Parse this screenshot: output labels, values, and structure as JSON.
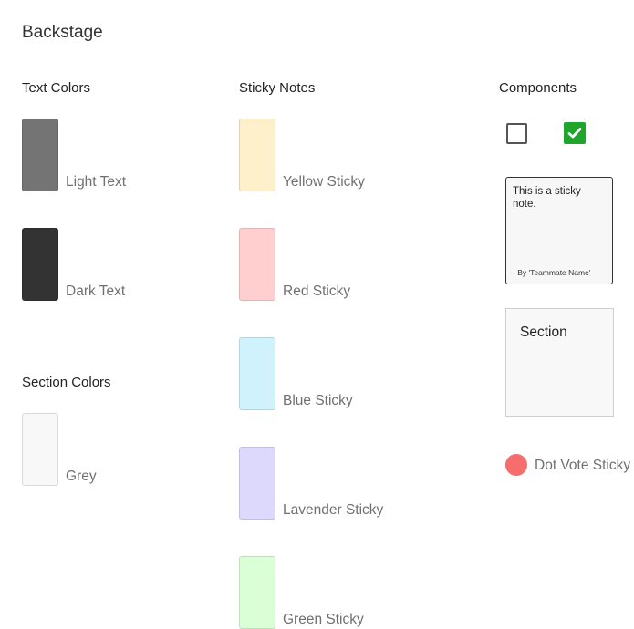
{
  "title": "Backstage",
  "text_colors": {
    "heading": "Text Colors",
    "items": [
      {
        "label": "Light Text",
        "color": "#747474"
      },
      {
        "label": "Dark Text",
        "color": "#333333"
      }
    ]
  },
  "section_colors": {
    "heading": "Section Colors",
    "items": [
      {
        "label": "Grey",
        "color": "#f8f8f8"
      }
    ]
  },
  "sticky_notes": {
    "heading": "Sticky Notes",
    "items": [
      {
        "label": "Yellow Sticky",
        "color": "#fff0cc"
      },
      {
        "label": "Red Sticky",
        "color": "#ffcfd0"
      },
      {
        "label": "Blue Sticky",
        "color": "#cff2fc"
      },
      {
        "label": "Lavender Sticky",
        "color": "#dcd9fd"
      },
      {
        "label": "Green Sticky",
        "color": "#dafed5"
      }
    ]
  },
  "components": {
    "heading": "Components",
    "checkbox_unchecked": {
      "checked": false
    },
    "checkbox_checked": {
      "checked": true,
      "color": "#1fa52b",
      "icon": "checkmark-icon"
    },
    "sticky_card": {
      "text": "This is a sticky note.",
      "author": "- By 'Teammate Name'"
    },
    "section_card": {
      "title": "Section"
    },
    "dot_vote": {
      "label": "Dot Vote Sticky",
      "color": "#f46e6e"
    }
  }
}
